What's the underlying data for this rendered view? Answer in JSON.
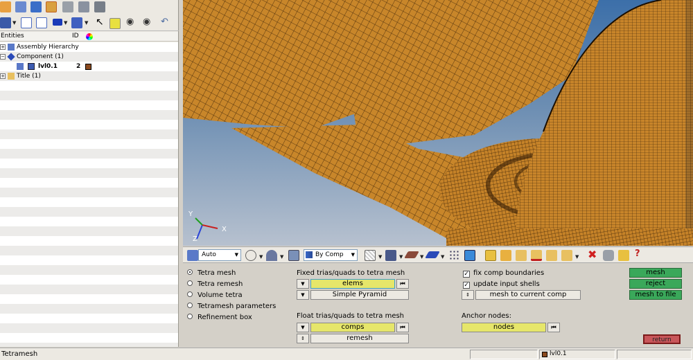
{
  "entity_browser": {
    "columns": [
      "Entities",
      "ID"
    ],
    "items": [
      {
        "label": "Assembly Hierarchy",
        "id": ""
      },
      {
        "label": "Component (1)",
        "id": ""
      },
      {
        "label": "lvl0.1",
        "id": "2",
        "color": "#8b4a1e"
      },
      {
        "label": "Title (1)",
        "id": ""
      }
    ]
  },
  "viewport": {
    "axes": {
      "y": "Y",
      "z": "Z",
      "x": "X"
    },
    "mesh_color": "#c8862a",
    "background_top": "#3c6fa9"
  },
  "view_toolbar": {
    "mode_value": "Auto",
    "color_by_value": "By Comp"
  },
  "panel": {
    "options": [
      {
        "label": "Tetra mesh",
        "selected": true
      },
      {
        "label": "Tetra remesh",
        "selected": false
      },
      {
        "label": "Volume tetra",
        "selected": false
      },
      {
        "label": "Tetramesh parameters",
        "selected": false
      },
      {
        "label": "Refinement box",
        "selected": false
      }
    ],
    "fixed_label": "Fixed trias/quads to tetra mesh",
    "fixed_selector": "elems",
    "fixed_method": "Simple Pyramid",
    "float_label": "Float trias/quads to tetra mesh",
    "float_selector": "comps",
    "float_method": "remesh",
    "fix_comp_boundaries": "fix comp boundaries",
    "update_input_shells": "update input shells",
    "mesh_to_current": "mesh to current comp",
    "anchor_label": "Anchor nodes:",
    "anchor_selector": "nodes",
    "buttons": {
      "mesh": "mesh",
      "reject": "reject",
      "mesh_to_file": "mesh to file",
      "return": "return"
    }
  },
  "status": {
    "message": "Tetramesh",
    "component": "lvl0.1",
    "component_color": "#8b4a1e"
  }
}
